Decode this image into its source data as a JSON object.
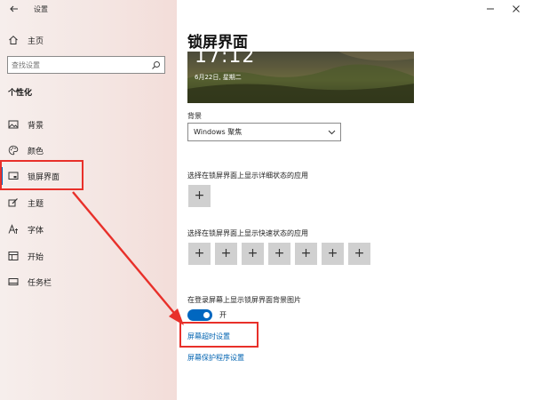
{
  "window": {
    "title": "设置"
  },
  "sidebar": {
    "home_label": "主页",
    "search_placeholder": "查找设置",
    "section_title": "个性化",
    "items": [
      {
        "label": "背景",
        "icon": "image-icon"
      },
      {
        "label": "颜色",
        "icon": "palette-icon"
      },
      {
        "label": "锁屏界面",
        "icon": "lock-screen-icon",
        "selected": true
      },
      {
        "label": "主题",
        "icon": "brush-icon"
      },
      {
        "label": "字体",
        "icon": "font-icon"
      },
      {
        "label": "开始",
        "icon": "start-icon"
      },
      {
        "label": "任务栏",
        "icon": "taskbar-icon"
      }
    ]
  },
  "main": {
    "title": "锁屏界面",
    "preview": {
      "time": "17:12",
      "date": "6月22日, 星期二"
    },
    "background_label": "背景",
    "background_value": "Windows 聚焦",
    "detailed_status_label": "选择在锁屏界面上显示详细状态的应用",
    "quick_status_label": "选择在锁屏界面上显示快速状态的应用",
    "plus_glyph": "+",
    "quick_status_count": 7,
    "signin_bg_label": "在登录屏幕上显示锁屏界面背景图片",
    "signin_bg_state": "开",
    "signin_bg_on": true,
    "timeout_link": "屏幕超时设置",
    "screensaver_link": "屏幕保护程序设置"
  },
  "colors": {
    "accent": "#0067c0",
    "annotation_red": "#e8302a",
    "link": "#0063b1"
  }
}
